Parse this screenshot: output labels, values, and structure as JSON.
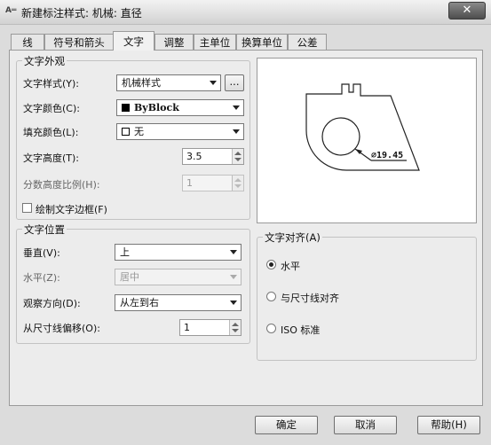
{
  "window": {
    "app_icon": "A═",
    "title": "新建标注样式: 机械: 直径",
    "close_symbol": "✕"
  },
  "tabs": [
    "线",
    "符号和箭头",
    "文字",
    "调整",
    "主单位",
    "换算单位",
    "公差"
  ],
  "active_tab": "文字",
  "text_appearance": {
    "legend": "文字外观",
    "style_label": "文字样式(Y):",
    "style_value": "机械样式",
    "browse_label": "...",
    "color_label": "文字颜色(C):",
    "color_value": "ByBlock",
    "color_swatch": "#000000",
    "fill_label": "填充颜色(L):",
    "fill_value": "无",
    "fill_swatch": "#ffffff",
    "height_label": "文字高度(T):",
    "height_value": "3.5",
    "fraction_label": "分数高度比例(H):",
    "fraction_value": "1",
    "frame_label": "绘制文字边框(F)",
    "frame_checked": false
  },
  "text_placement": {
    "legend": "文字位置",
    "vertical_label": "垂直(V):",
    "vertical_value": "上",
    "horizontal_label": "水平(Z):",
    "horizontal_value": "居中",
    "view_label": "观察方向(D):",
    "view_value": "从左到右",
    "offset_label": "从尺寸线偏移(O):",
    "offset_value": "1"
  },
  "text_alignment": {
    "legend": "文字对齐(A)",
    "options": [
      "水平",
      "与尺寸线对齐",
      "ISO 标准"
    ],
    "selected": "水平"
  },
  "preview": {
    "dimension_text": "⌀19.45"
  },
  "buttons": {
    "ok": "确定",
    "cancel": "取消",
    "help": "帮助(H)"
  }
}
